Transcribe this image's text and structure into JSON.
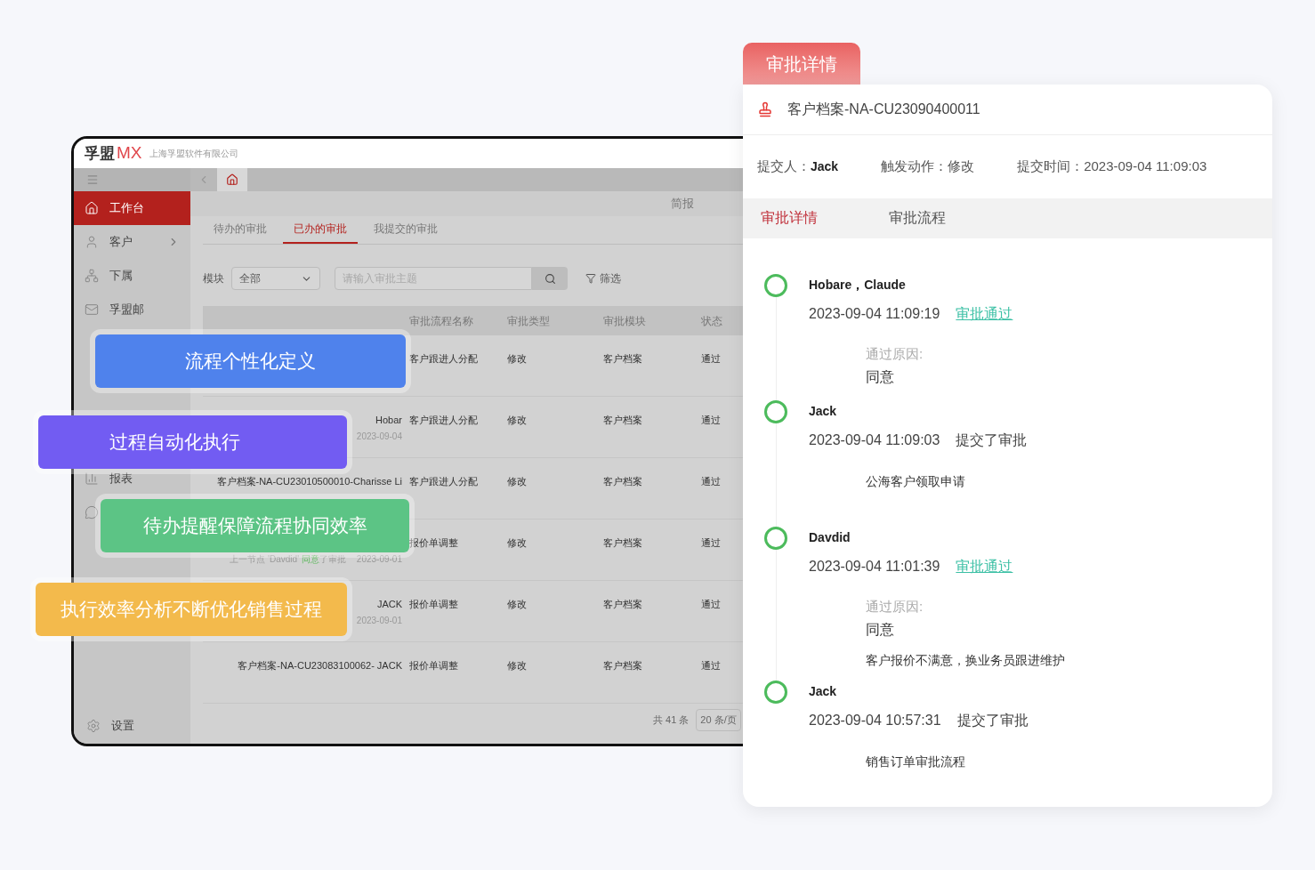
{
  "app": {
    "logo_cn": "孚盟",
    "logo_mx": "MX",
    "company": "上海孚盟软件有限公司",
    "sidebar": {
      "items": [
        {
          "kind": "home",
          "label": "工作台",
          "selected": true,
          "chevron": false
        },
        {
          "kind": "user",
          "label": "客户",
          "selected": false,
          "chevron": true
        },
        {
          "kind": "tree",
          "label": "下属",
          "selected": false,
          "chevron": false
        },
        {
          "kind": "mail",
          "label": "孚盟邮",
          "selected": false,
          "chevron": false
        }
      ],
      "lower_items": [
        {
          "kind": "chart",
          "label": "报表",
          "selected": false,
          "chevron": false
        },
        {
          "kind": "chat",
          "selected": false,
          "chevron": false
        }
      ],
      "settings": "设置"
    },
    "top_link": "简报",
    "tabs": [
      {
        "label": "待办的审批",
        "selected": false
      },
      {
        "label": "已办的审批",
        "selected": true
      },
      {
        "label": "我提交的审批",
        "selected": false
      }
    ],
    "filter": {
      "label": "模块",
      "select": "全部",
      "placeholder": "请输入审批主题",
      "filter_button": "筛选"
    },
    "table": {
      "columns": [
        "审批流程名称",
        "审批类型",
        "审批模块",
        "状态"
      ],
      "rows": [
        {
          "flow": "客户跟进人分配",
          "type": "修改",
          "module": "客户档案",
          "status": "通过"
        },
        {
          "subject": "Hobar",
          "date": "2023-09-04",
          "flow": "客户跟进人分配",
          "type": "修改",
          "module": "客户档案",
          "status": "通过"
        },
        {
          "subject": "客户档案-NA-CU23010500010-Charisse Li",
          "flow": "客户跟进人分配",
          "type": "修改",
          "module": "客户档案",
          "status": "通过"
        },
        {
          "note": {
            "prefix": "上一节点 'Davdid'",
            "action": "同意",
            "suffix": "了审批"
          },
          "date": "2023-09-01",
          "flow": "报价单调整",
          "type": "修改",
          "module": "客户档案",
          "status": "通过"
        },
        {
          "subject": "JACK",
          "date": "2023-09-01",
          "flow": "报价单调整",
          "type": "修改",
          "module": "客户档案",
          "status": "通过"
        },
        {
          "subject": "客户档案-NA-CU23083100062- JACK",
          "flow": "报价单调整",
          "type": "修改",
          "module": "客户档案",
          "status": "通过"
        }
      ]
    },
    "footer": {
      "total": "共 41 条",
      "page_size": "20 条/页"
    }
  },
  "features": [
    {
      "label": "流程个性化定义",
      "color": "#4f82ec"
    },
    {
      "label": "过程自动化执行",
      "color": "#725cf2"
    },
    {
      "label": "待办提醒保障流程协同效率",
      "color": "#5cc485"
    },
    {
      "label": "执行效率分析不断优化销售过程",
      "color": "#f3ba4c"
    }
  ],
  "detail": {
    "badge": "审批详情",
    "record": "客户档案-NA-CU23090400011",
    "info": [
      {
        "label": "提交人：",
        "value": "Jack"
      },
      {
        "label": "触发动作：",
        "value": "修改"
      },
      {
        "label": "提交时间：",
        "value": "2023-09-04 11:09:03"
      }
    ],
    "tabs": [
      {
        "label": "审批详情",
        "selected": true
      },
      {
        "label": "审批流程",
        "selected": false
      }
    ],
    "timeline": [
      {
        "name": "Hobare，Claude",
        "time": "2023-09-04 11:09:19",
        "action": "审批通过",
        "kind": "approved",
        "reason_label": "通过原因:",
        "reason": "同意"
      },
      {
        "name": "Jack",
        "time": "2023-09-04 11:09:03",
        "action": "提交了审批",
        "kind": "submitted",
        "note": "公海客户领取申请"
      },
      {
        "name": "Davdid",
        "time": "2023-09-04 11:01:39",
        "action": "审批通过",
        "kind": "approved",
        "reason_label": "通过原因:",
        "reason": "同意",
        "note": "客户报价不满意，换业务员跟进维护"
      },
      {
        "name": "Jack",
        "time": "2023-09-04 10:57:31",
        "action": "提交了审批",
        "kind": "submitted",
        "note": "销售订单审批流程"
      }
    ]
  }
}
